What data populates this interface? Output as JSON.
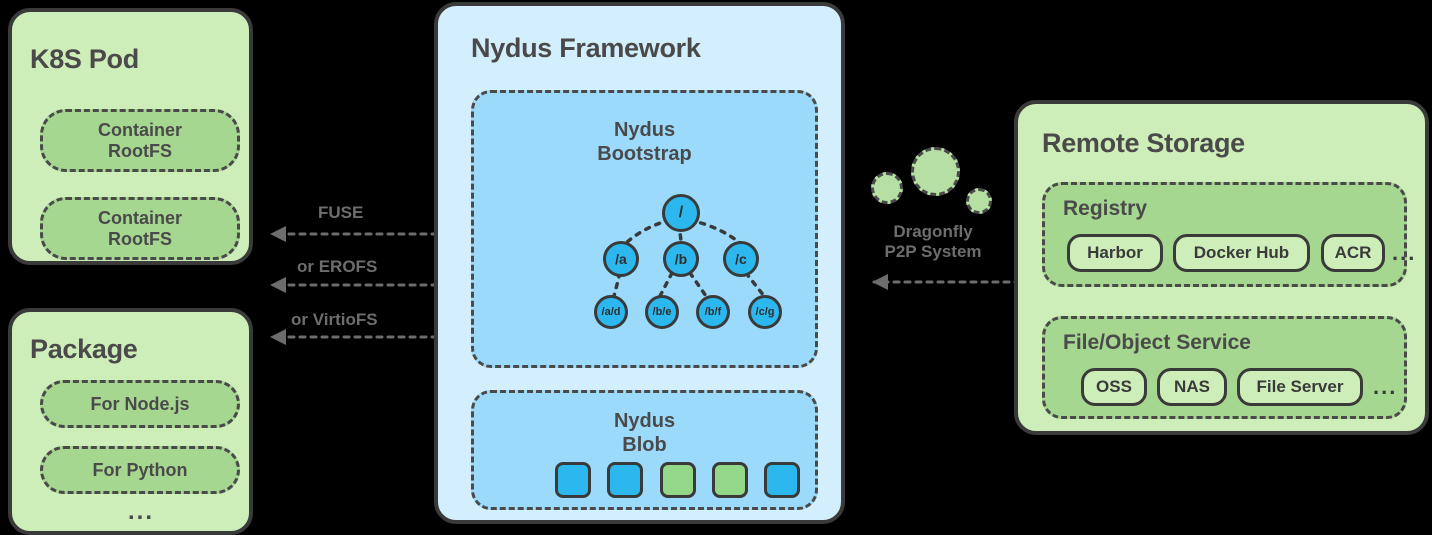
{
  "colors": {
    "background": "#000000",
    "panel_green": "#cdeeb9",
    "panel_blue": "#d3effd",
    "capsule_green": "#a6d790",
    "inner_blue": "#9cdafc",
    "chunk_blue": "#2cb8ee",
    "chunk_green": "#93d889",
    "stroke_dark": "#3a3a3a",
    "text_dark": "#4a4a4a",
    "text_gray": "#6d6d6d"
  },
  "k8s_pod": {
    "title": "K8S Pod",
    "items": [
      {
        "label": "Container\nRootFS"
      },
      {
        "label": "Container\nRootFS"
      }
    ]
  },
  "package": {
    "title": "Package",
    "items": [
      {
        "label": "For Node.js"
      },
      {
        "label": "For Python"
      }
    ],
    "ellipsis": "..."
  },
  "connections": [
    {
      "label": "FUSE"
    },
    {
      "label": "or EROFS"
    },
    {
      "label": "or VirtioFS"
    }
  ],
  "nydus_framework": {
    "title": "Nydus Framework",
    "bootstrap": {
      "title": "Nydus\nBootstrap",
      "nodes": [
        {
          "id": "root",
          "label": "/"
        },
        {
          "id": "a",
          "label": "/a"
        },
        {
          "id": "b",
          "label": "/b"
        },
        {
          "id": "c",
          "label": "/c"
        },
        {
          "id": "ad",
          "label": "/a/d"
        },
        {
          "id": "be",
          "label": "/b/e"
        },
        {
          "id": "bf",
          "label": "/b/f"
        },
        {
          "id": "cg",
          "label": "/c/g"
        }
      ],
      "edges": [
        {
          "from": "root",
          "to": "a"
        },
        {
          "from": "root",
          "to": "b"
        },
        {
          "from": "root",
          "to": "c"
        },
        {
          "from": "a",
          "to": "ad"
        },
        {
          "from": "b",
          "to": "be"
        },
        {
          "from": "b",
          "to": "bf"
        },
        {
          "from": "c",
          "to": "cg"
        }
      ]
    },
    "blob": {
      "title": "Nydus\nBlob",
      "chunks": [
        {
          "color": "#2cb8ee"
        },
        {
          "color": "#2cb8ee"
        },
        {
          "color": "#93d889"
        },
        {
          "color": "#93d889"
        },
        {
          "color": "#2cb8ee"
        }
      ]
    }
  },
  "dragonfly": {
    "label": "Dragonfly\nP2P System",
    "bubbles": [
      {
        "size": 30
      },
      {
        "size": 48
      },
      {
        "size": 24
      }
    ]
  },
  "remote_storage": {
    "title": "Remote Storage",
    "groups": [
      {
        "title": "Registry",
        "chips": [
          {
            "label": "Harbor"
          },
          {
            "label": "Docker Hub"
          },
          {
            "label": "ACR"
          }
        ],
        "ellipsis": "..."
      },
      {
        "title": "File/Object Service",
        "chips": [
          {
            "label": "OSS"
          },
          {
            "label": "NAS"
          },
          {
            "label": "File Server"
          }
        ],
        "ellipsis": "..."
      }
    ]
  }
}
